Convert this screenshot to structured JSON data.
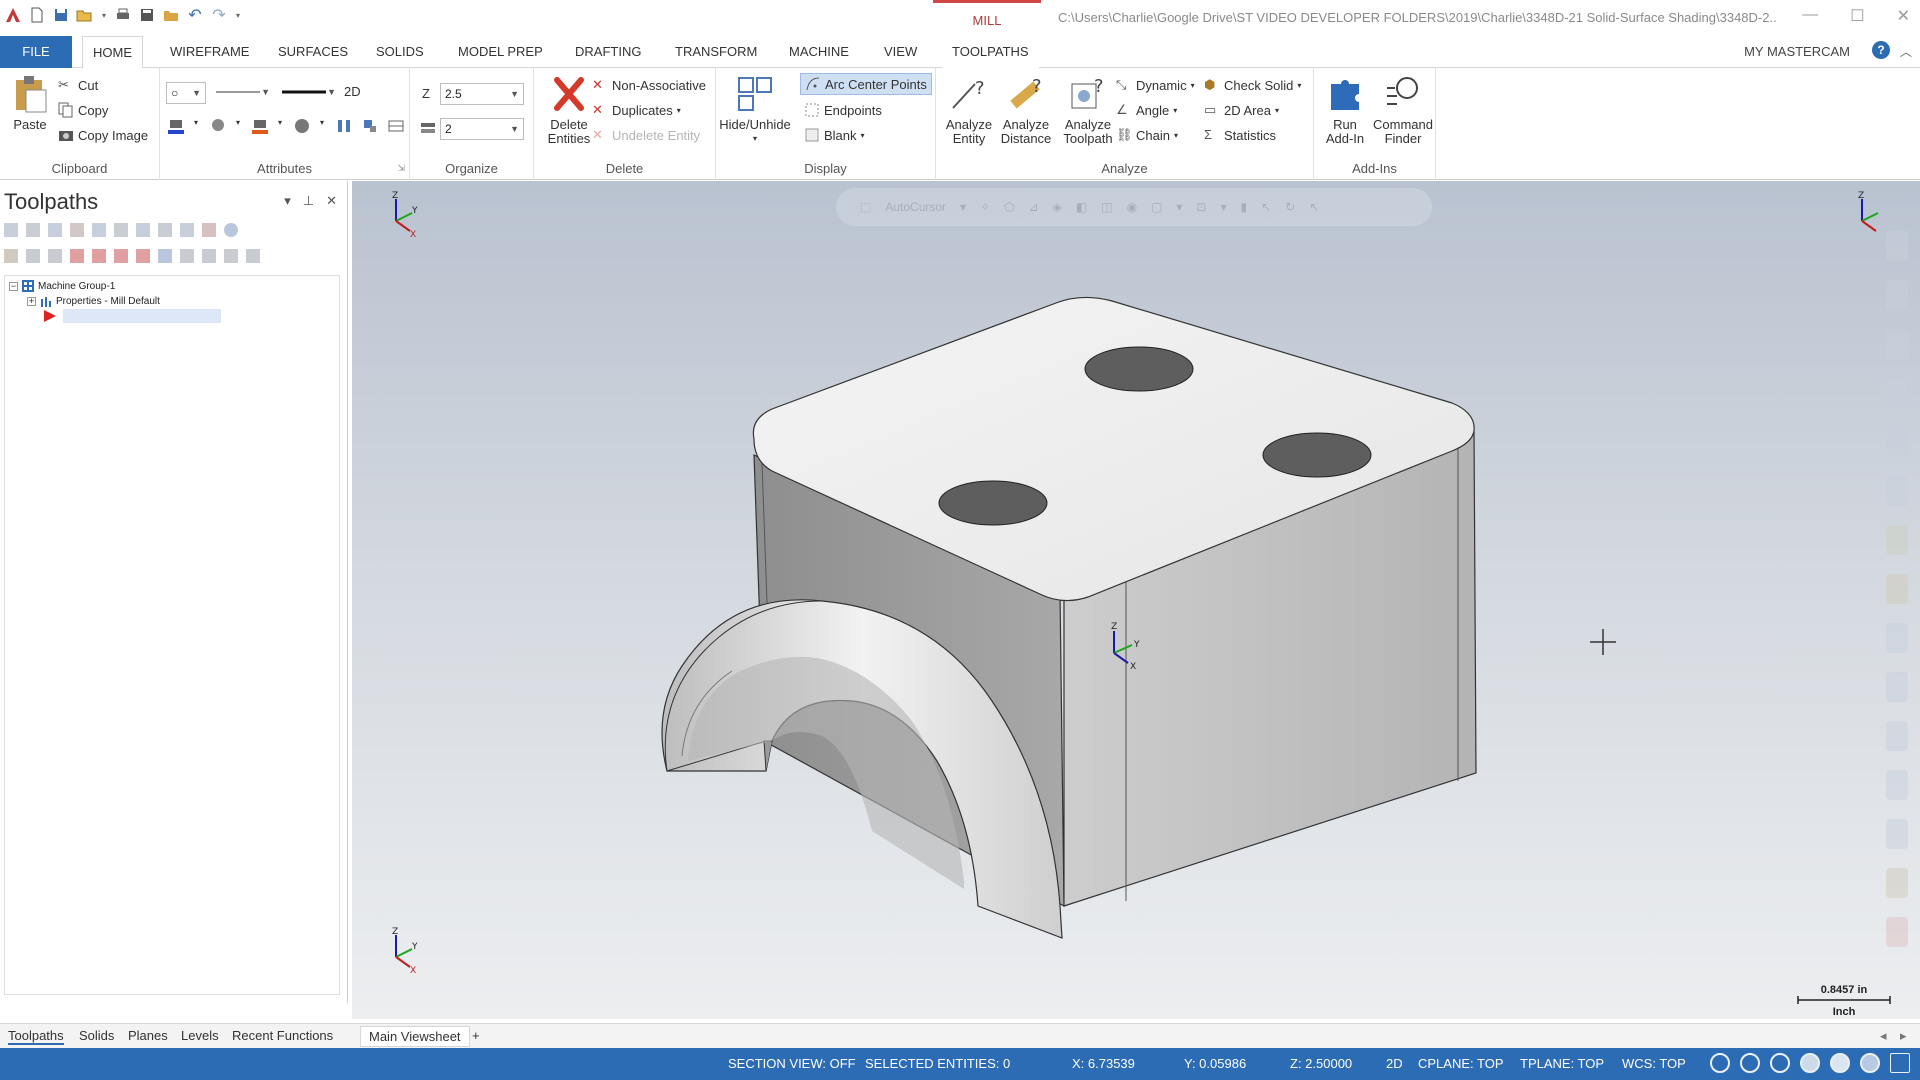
{
  "title_bar": {
    "context_tab": "MILL",
    "document_path": "C:\\Users\\Charlie\\Google Drive\\ST VIDEO DEVELOPER FOLDERS\\2019\\Charlie\\3348D-21 Solid-Surface Shading\\3348D-2..."
  },
  "tabs": [
    "FILE",
    "HOME",
    "WIREFRAME",
    "SURFACES",
    "SOLIDS",
    "MODEL PREP",
    "DRAFTING",
    "TRANSFORM",
    "MACHINE",
    "VIEW",
    "TOOLPATHS"
  ],
  "active_tab": "HOME",
  "my_mastercam": "MY MASTERCAM",
  "ribbon": {
    "clipboard": {
      "label": "Clipboard",
      "paste": "Paste",
      "cut": "Cut",
      "copy": "Copy",
      "copy_image": "Copy Image"
    },
    "attributes": {
      "label": "Attributes",
      "mode_2d": "2D"
    },
    "organize": {
      "label": "Organize",
      "z_label": "Z",
      "z_value": "2.5",
      "level_value": "2"
    },
    "delete": {
      "label": "Delete",
      "delete_entities": "Delete\nEntities",
      "non_associative": "Non-Associative",
      "duplicates": "Duplicates",
      "undelete_entity": "Undelete Entity"
    },
    "display": {
      "label": "Display",
      "hide_unhide": "Hide/Unhide",
      "arc_center_points": "Arc Center Points",
      "endpoints": "Endpoints",
      "blank": "Blank"
    },
    "analyze": {
      "label": "Analyze",
      "analyze_entity": "Analyze\nEntity",
      "analyze_distance": "Analyze\nDistance",
      "analyze_toolpath": "Analyze\nToolpath",
      "dynamic": "Dynamic",
      "angle": "Angle",
      "chain": "Chain",
      "check_solid": "Check Solid",
      "area_2d": "2D Area",
      "statistics": "Statistics"
    },
    "addins": {
      "label": "Add-Ins",
      "run_addin": "Run\nAdd-In",
      "command_finder": "Command\nFinder"
    }
  },
  "toolpaths_panel": {
    "title": "Toolpaths",
    "tree": {
      "machine_group": "Machine Group-1",
      "properties": "Properties - Mill Default"
    }
  },
  "viewport": {
    "float_toolbar_label": "AutoCursor",
    "scale_value": "0.8457 in",
    "scale_unit": "Inch"
  },
  "bottom_tabs": [
    "Toolpaths",
    "Solids",
    "Planes",
    "Levels",
    "Recent Functions"
  ],
  "viewsheet_tab": "Main Viewsheet",
  "viewsheet_add": "+",
  "status_bar": {
    "section_view": "SECTION VIEW: OFF",
    "selected_entities": "SELECTED ENTITIES: 0",
    "x": "X:  6.73539",
    "y": "Y:  0.05986",
    "z": "Z:  2.50000",
    "mode": "2D",
    "cplane": "CPLANE: TOP",
    "tplane": "TPLANE: TOP",
    "wcs": "WCS: TOP"
  },
  "colors": {
    "accent": "#2c6cb5",
    "context": "#d04545"
  }
}
